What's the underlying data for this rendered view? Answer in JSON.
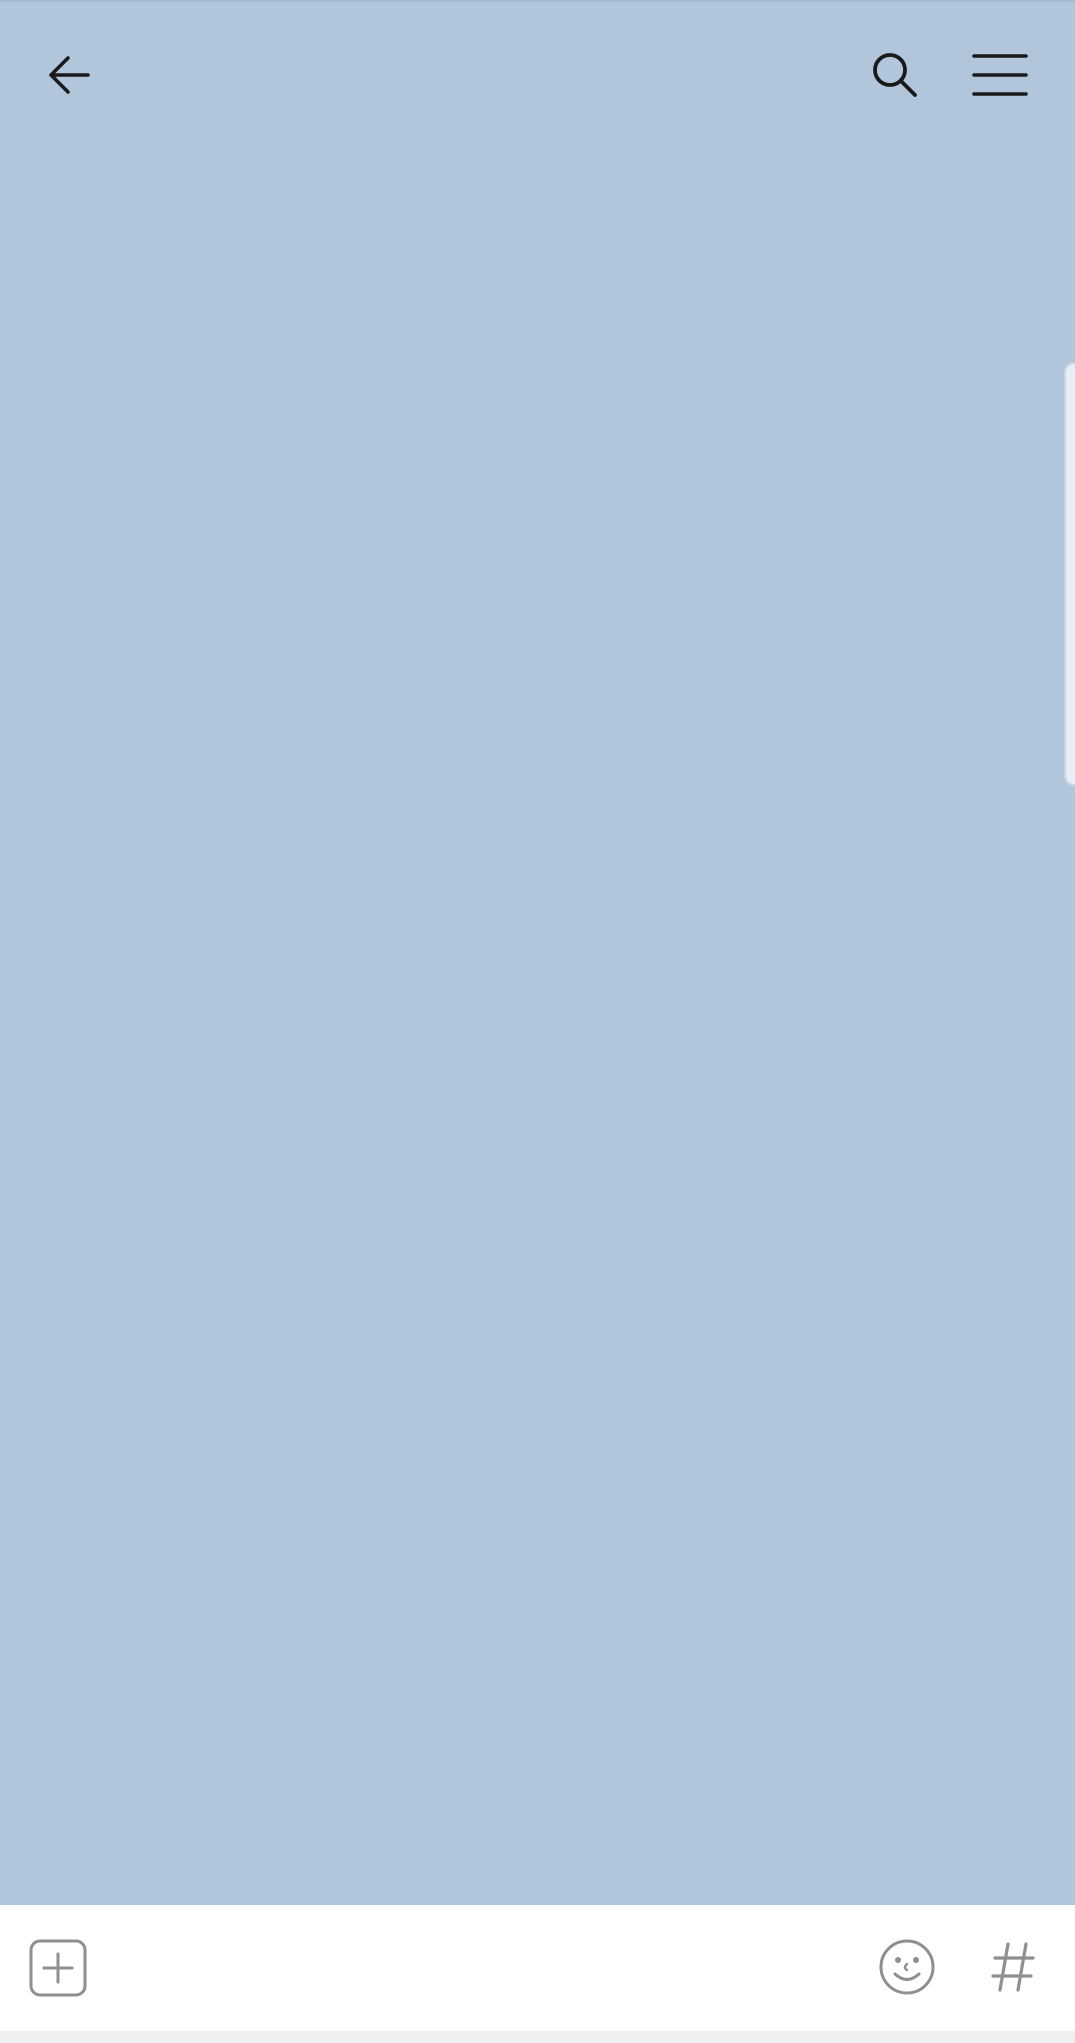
{
  "colors": {
    "chat_background": "#b1c6db",
    "input_bar_background": "#ffffff",
    "header_icon_color": "#1a1a1a",
    "input_icon_color": "#8e8e93"
  },
  "header": {
    "icons": {
      "back": "back-arrow-icon",
      "search": "search-icon",
      "menu": "hamburger-menu-icon"
    }
  },
  "input_bar": {
    "icons": {
      "attach": "plus-square-icon",
      "emoji": "smiley-face-icon",
      "hashtag": "hashtag-icon"
    },
    "hashtag_label": "#"
  }
}
